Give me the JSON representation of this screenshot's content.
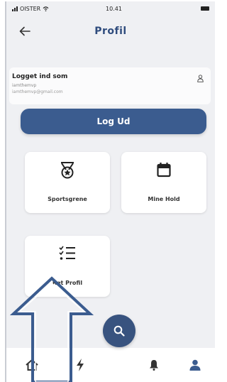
{
  "status_bar": {
    "carrier": "OISTER",
    "time": "10.41"
  },
  "header": {
    "title": "Profil",
    "back_icon": "arrow-left-icon"
  },
  "login_card": {
    "title": "Logget ind som",
    "username": "iamthemvp",
    "email": "iamthemvp@gmail.com",
    "icon": "user-outline-icon"
  },
  "logout_button": {
    "label": "Log Ud"
  },
  "tiles": [
    {
      "label": "Sportsgrene",
      "icon": "medal-star-icon"
    },
    {
      "label": "Mine Hold",
      "icon": "calendar-icon"
    },
    {
      "label": "Ret Profil",
      "icon": "checklist-icon"
    }
  ],
  "bottom_nav": {
    "items": [
      "home-icon",
      "bolt-icon",
      "search-icon",
      "bell-icon",
      "user-icon"
    ],
    "active": "user-icon"
  },
  "colors": {
    "primary": "#3b5c8f",
    "title": "#2f4c7d",
    "background": "#eff0f3",
    "annotation_arrow": "#3b5c8f"
  }
}
